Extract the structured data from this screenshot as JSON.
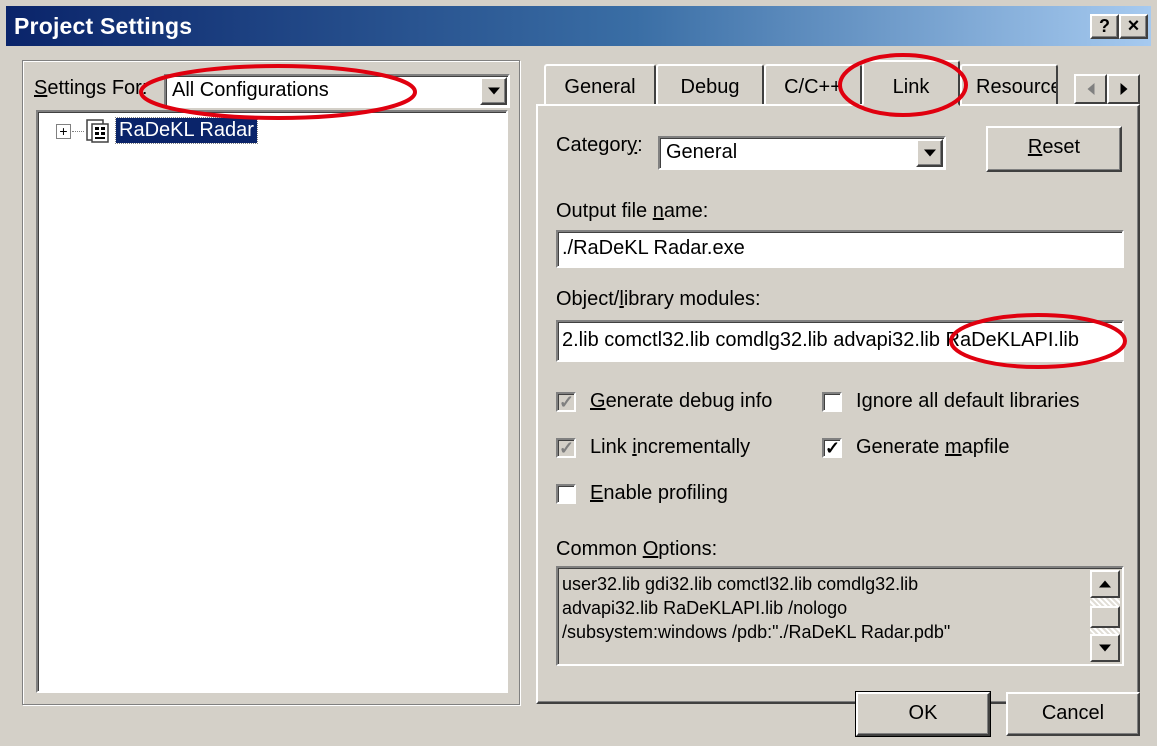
{
  "window": {
    "title": "Project Settings",
    "help_glyph": "?",
    "close_glyph": "×"
  },
  "left": {
    "settings_for_label_prefix": "S",
    "settings_for_label_rest": "ettings For:",
    "configuration": "All Configurations",
    "tree": {
      "expander": "+",
      "project_name": "RaDeKL Radar"
    }
  },
  "tabs": [
    {
      "label": "General"
    },
    {
      "label": "Debug"
    },
    {
      "label": "C/C++"
    },
    {
      "label": "Link"
    },
    {
      "label": "Resources"
    }
  ],
  "link": {
    "category_label_pre": "Categor",
    "category_label_u": "y",
    "category_label_post": ":",
    "category_value": "General",
    "reset_u": "R",
    "reset_rest": "eset",
    "output_label_pre": "Output file ",
    "output_label_u": "n",
    "output_label_post": "ame:",
    "output_value": "./RaDeKL Radar.exe",
    "modules_label_pre": "Object/",
    "modules_label_u": "l",
    "modules_label_post": "ibrary modules:",
    "modules_value": "2.lib comctl32.lib comdlg32.lib advapi32.lib RaDeKLAPI.lib",
    "checkboxes": {
      "debug_info": {
        "u": "G",
        "rest": "enerate debug info"
      },
      "ignore_libs": {
        "pre": "I",
        "u": "g",
        "rest": "nore all default libraries"
      },
      "incremental": {
        "pre": "Link ",
        "u": "i",
        "rest": "ncrementally"
      },
      "mapfile": {
        "pre": "Generate ",
        "u": "m",
        "rest": "apfile"
      },
      "profiling": {
        "u": "E",
        "rest": "nable profiling"
      }
    },
    "check_glyph": "✓",
    "common_label_pre": "Common ",
    "common_label_u": "O",
    "common_label_post": "ptions:",
    "common_value": "user32.lib gdi32.lib comctl32.lib comdlg32.lib\nadvapi32.lib RaDeKLAPI.lib /nologo\n/subsystem:windows /pdb:\"./RaDeKL Radar.pdb\""
  },
  "footer": {
    "ok_label": "OK",
    "cancel_label": "Cancel"
  },
  "colors": {
    "titlebar_start": "#0a246a",
    "titlebar_end": "#a6caf0",
    "annotation": "#e0000f",
    "face": "#d4d0c8"
  }
}
